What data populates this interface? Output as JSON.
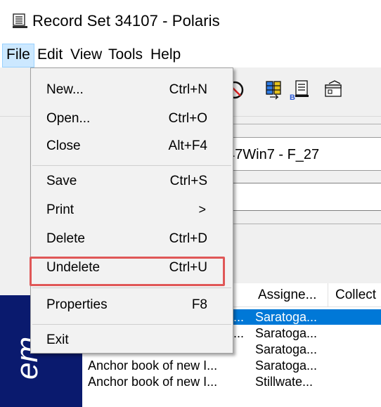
{
  "window": {
    "title": "Record Set 34107 - Polaris",
    "icon": "record-set-icon"
  },
  "menubar": {
    "items": [
      "File",
      "Edit",
      "View",
      "Tools",
      "Help"
    ],
    "active": "File"
  },
  "file_menu": {
    "items": [
      {
        "label": "New...",
        "shortcut": "Ctrl+N"
      },
      {
        "label": "Open...",
        "shortcut": "Ctrl+O"
      },
      {
        "label": "Close",
        "shortcut": "Alt+F4"
      },
      {
        "label": "Save",
        "shortcut": "Ctrl+S"
      },
      {
        "label": "Print",
        "shortcut": "",
        "submenu_arrow": ">"
      },
      {
        "label": "Delete",
        "shortcut": "Ctrl+D"
      },
      {
        "label": "Undelete",
        "shortcut": "Ctrl+U"
      },
      {
        "label": "Properties",
        "shortcut": "F8"
      },
      {
        "label": "Exit",
        "shortcut": ""
      }
    ],
    "highlighted_item": "Undelete",
    "highlight_color": "#e05757"
  },
  "background": {
    "record_name_fragment": "47Win7 - F_27",
    "side_label_fragment": "em"
  },
  "grid": {
    "columns": [
      "Assigne...",
      "Collect"
    ],
    "rows": [
      {
        "title": "...",
        "assigned": "Saratoga...",
        "selected": true
      },
      {
        "title": "...",
        "assigned": "Saratoga...",
        "selected": false
      },
      {
        "title": "Anchor book of new I...",
        "assigned": "Saratoga...",
        "selected": false
      },
      {
        "title": "Anchor book of new I...",
        "assigned": "Saratoga...",
        "selected": false
      },
      {
        "title": "Anchor book of new I...",
        "assigned": "Stillwate...",
        "selected": false
      }
    ],
    "selection_color": "#0078d7"
  },
  "toolbar": {
    "icons": [
      "no-entry-icon",
      "columns-icon",
      "bibliographic-icon",
      "properties-icon"
    ]
  },
  "colors": {
    "menu_active_bg": "#cce8ff",
    "side_band": "#0a1a6e"
  }
}
